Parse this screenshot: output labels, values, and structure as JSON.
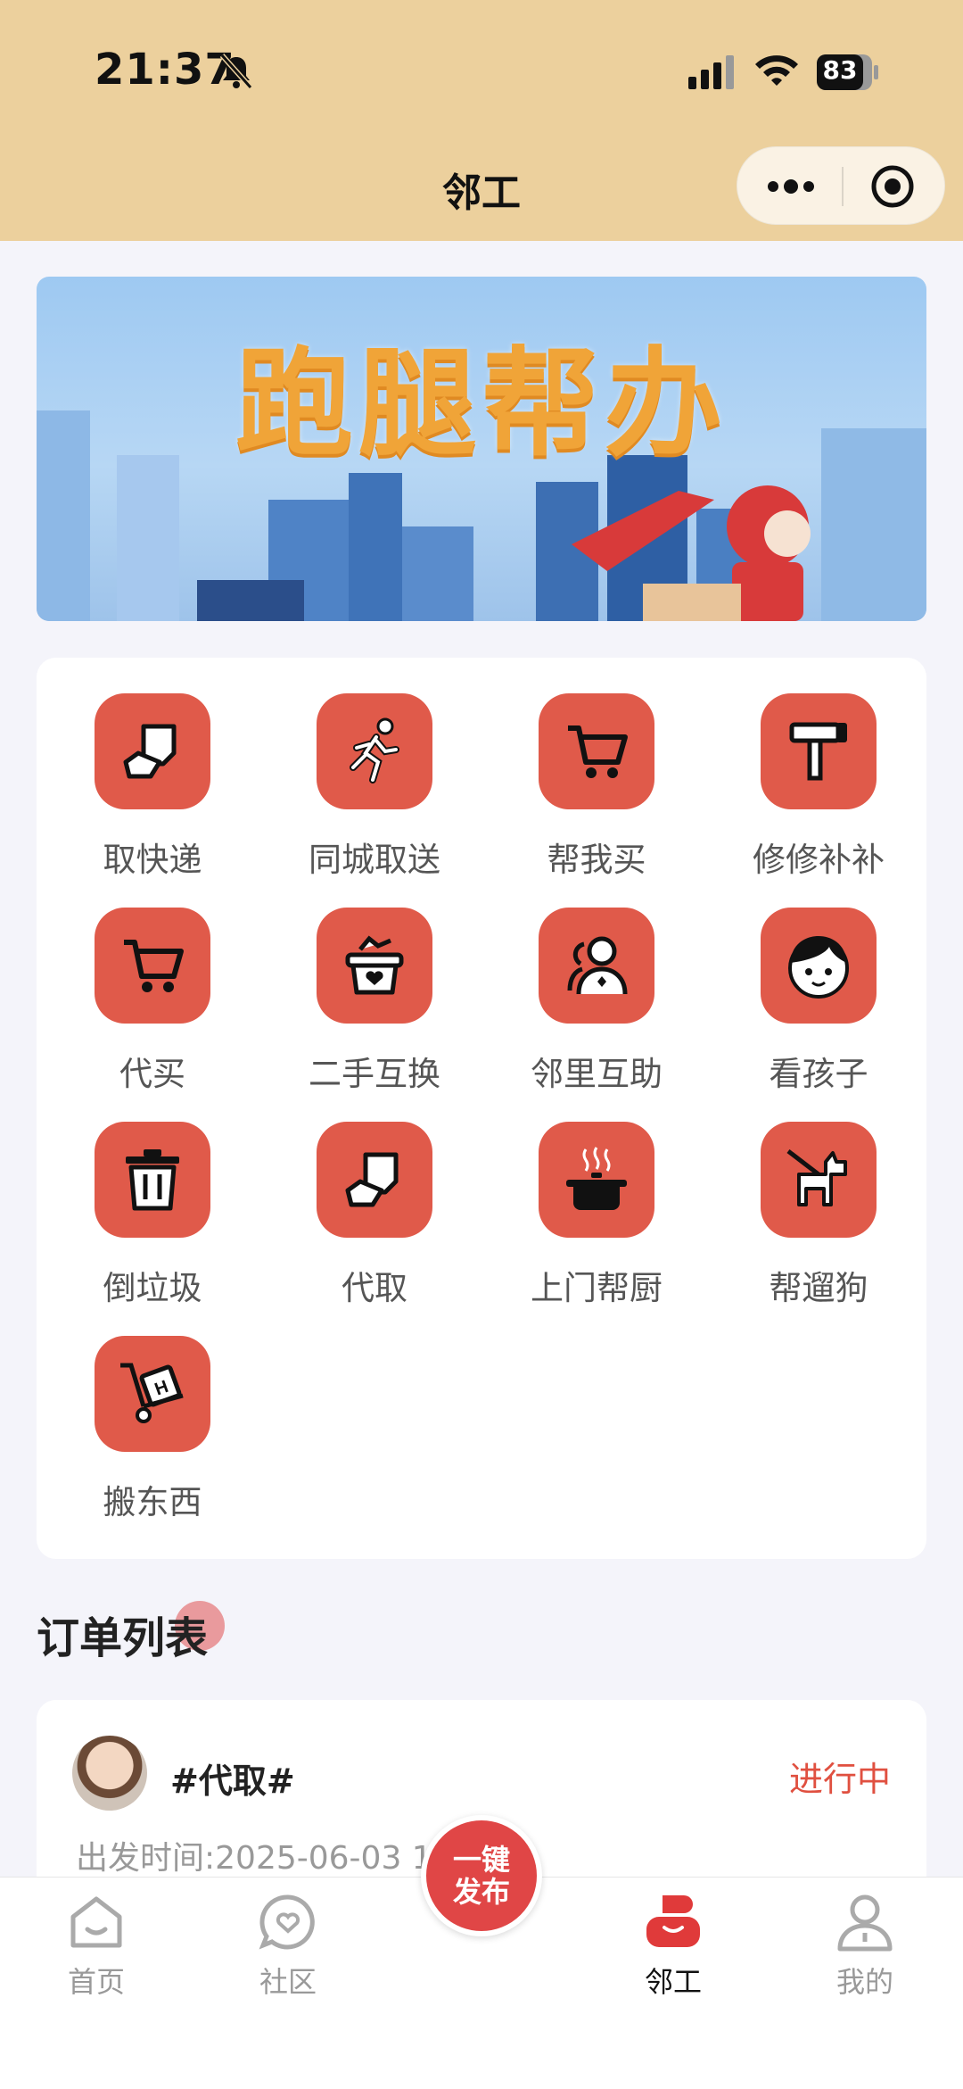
{
  "status": {
    "time": "21:37",
    "battery": "83"
  },
  "nav": {
    "title": "邻工"
  },
  "banner": {
    "title": "跑腿帮办"
  },
  "services": [
    {
      "label": "取快递",
      "icon": "package-hand-icon"
    },
    {
      "label": "同城取送",
      "icon": "running-man-icon"
    },
    {
      "label": "帮我买",
      "icon": "shopping-cart-icon"
    },
    {
      "label": "修修补补",
      "icon": "hammer-icon"
    },
    {
      "label": "代买",
      "icon": "shopping-cart-icon"
    },
    {
      "label": "二手互换",
      "icon": "gift-basket-icon"
    },
    {
      "label": "邻里互助",
      "icon": "people-icon"
    },
    {
      "label": "看孩子",
      "icon": "child-face-icon"
    },
    {
      "label": "倒垃圾",
      "icon": "trash-icon"
    },
    {
      "label": "代取",
      "icon": "package-hand-icon"
    },
    {
      "label": "上门帮厨",
      "icon": "cooking-pot-icon"
    },
    {
      "label": "帮遛狗",
      "icon": "dog-icon"
    },
    {
      "label": "搬东西",
      "icon": "hand-truck-icon"
    }
  ],
  "orders": {
    "section_title": "订单列表",
    "items": [
      {
        "tag": "#代取#",
        "status": "进行中",
        "time_label": "出发时间:2025-06-03 1"
      }
    ]
  },
  "fab": {
    "line1": "一键",
    "line2": "发布"
  },
  "tabs": [
    {
      "label": "首页",
      "icon": "home-icon"
    },
    {
      "label": "社区",
      "icon": "heart-chat-icon"
    },
    {
      "label": "邻工",
      "icon": "worker-icon"
    },
    {
      "label": "我的",
      "icon": "user-icon"
    }
  ],
  "colors": {
    "accent": "#e05a4a",
    "header": "#ecd09d",
    "status_active": "#e05040"
  }
}
